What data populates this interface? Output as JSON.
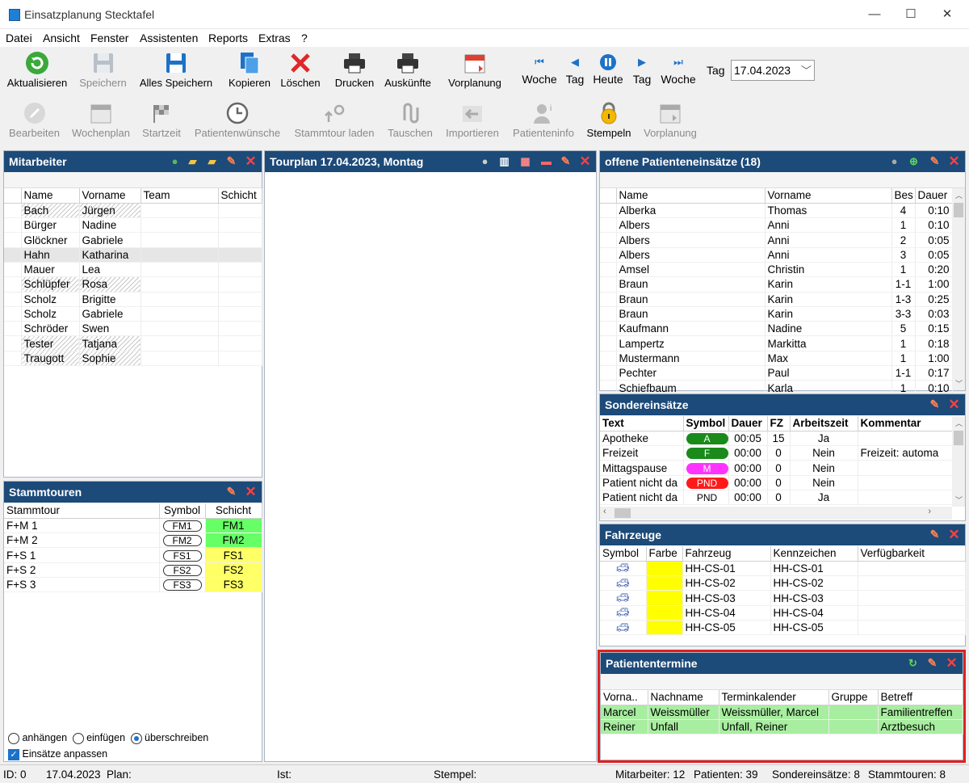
{
  "window": {
    "title": "Einsatzplanung Stecktafel",
    "minimize": "—",
    "maximize": "☐",
    "close": "✕"
  },
  "menu": [
    "Datei",
    "Ansicht",
    "Fenster",
    "Assistenten",
    "Reports",
    "Extras",
    "?"
  ],
  "toolbar1": [
    "Aktualisieren",
    "Speichern",
    "Alles Speichern",
    "Kopieren",
    "Löschen",
    "Drucken",
    "Auskünfte",
    "Vorplanung"
  ],
  "nav": {
    "week_back": "Woche",
    "day_back": "Tag",
    "today": "Heute",
    "day_fwd": "Tag",
    "week_fwd": "Woche",
    "date_label": "Tag",
    "date_value": "17.04.2023"
  },
  "toolbar2": [
    "Bearbeiten",
    "Wochenplan",
    "Startzeit",
    "Patientenwünsche",
    "Stammtour laden",
    "Tauschen",
    "Importieren",
    "Patienteninfo",
    "Stempeln",
    "Vorplanung"
  ],
  "mitarbeiter": {
    "title": "Mitarbeiter",
    "columns": [
      "Name",
      "Vorname",
      "Team",
      "Schicht"
    ],
    "rows": [
      [
        "Bach",
        "Jürgen"
      ],
      [
        "Bürger",
        "Nadine"
      ],
      [
        "Glöckner",
        "Gabriele"
      ],
      [
        "Hahn",
        "Katharina"
      ],
      [
        "Mauer",
        "Lea"
      ],
      [
        "Schlüpfer",
        "Rosa"
      ],
      [
        "Scholz",
        "Brigitte"
      ],
      [
        "Scholz",
        "Gabriele"
      ],
      [
        "Schröder",
        "Swen"
      ],
      [
        "Tester",
        "Tatjana"
      ],
      [
        "Traugott",
        "Sophie"
      ]
    ]
  },
  "tourplan": {
    "title": "Tourplan 17.04.2023, Montag"
  },
  "stammtouren": {
    "title": "Stammtouren",
    "columns": [
      "Stammtour",
      "Symbol",
      "Schicht"
    ],
    "rows": [
      [
        "F+M 1",
        "FM1",
        "FM1"
      ],
      [
        "F+M 2",
        "FM2",
        "FM2"
      ],
      [
        "F+S 1",
        "FS1",
        "FS1"
      ],
      [
        "F+S 2",
        "FS2",
        "FS2"
      ],
      [
        "F+S 3",
        "FS3",
        "FS3"
      ]
    ],
    "options": [
      "anhängen",
      "einfügen",
      "überschreiben"
    ],
    "checkbox": "Einsätze anpassen"
  },
  "offene": {
    "title": "offene Patienteneinsätze (18)",
    "columns": [
      "Name",
      "Vorname",
      "Bes",
      "Dauer"
    ],
    "rows": [
      [
        "Alberka",
        "Thomas",
        "4",
        "0:10"
      ],
      [
        "Albers",
        "Anni",
        "1",
        "0:10"
      ],
      [
        "Albers",
        "Anni",
        "2",
        "0:05"
      ],
      [
        "Albers",
        "Anni",
        "3",
        "0:05"
      ],
      [
        "Amsel",
        "Christin",
        "1",
        "0:20"
      ],
      [
        "Braun",
        "Karin",
        "1-1",
        "1:00"
      ],
      [
        "Braun",
        "Karin",
        "1-3",
        "0:25"
      ],
      [
        "Braun",
        "Karin",
        "3-3",
        "0:03"
      ],
      [
        "Kaufmann",
        "Nadine",
        "5",
        "0:15"
      ],
      [
        "Lampertz",
        "Markitta",
        "1",
        "0:18"
      ],
      [
        "Mustermann",
        "Max",
        "1",
        "1:00"
      ],
      [
        "Pechter",
        "Paul",
        "1-1",
        "0:17"
      ],
      [
        "Schiefbaum",
        "Karla",
        "1",
        "0:10"
      ]
    ]
  },
  "sonder": {
    "title": "Sondereinsätze",
    "columns": [
      "Text",
      "Symbol",
      "Dauer",
      "FZ",
      "Arbeitszeit",
      "Kommentar"
    ],
    "rows": [
      {
        "text": "Apotheke",
        "symbol": "A",
        "color": "#1a8a1a",
        "dauer": "00:05",
        "fz": "15",
        "az": "Ja",
        "kommentar": ""
      },
      {
        "text": "Freizeit",
        "symbol": "F",
        "color": "#1a8a1a",
        "dauer": "00:00",
        "fz": "0",
        "az": "Nein",
        "kommentar": "Freizeit: automa"
      },
      {
        "text": "Mittagspause",
        "symbol": "M",
        "color": "#ff33ff",
        "dauer": "00:00",
        "fz": "0",
        "az": "Nein",
        "kommentar": ""
      },
      {
        "text": "Patient nicht da",
        "symbol": "PND",
        "color": "#ff1a1a",
        "dauer": "00:00",
        "fz": "0",
        "az": "Nein",
        "kommentar": ""
      },
      {
        "text": "Patient nicht da",
        "symbol": "PND",
        "color": "",
        "dauer": "00:00",
        "fz": "0",
        "az": "Ja",
        "kommentar": ""
      }
    ]
  },
  "fahrzeuge": {
    "title": "Fahrzeuge",
    "columns": [
      "Symbol",
      "Farbe",
      "Fahrzeug",
      "Kennzeichen",
      "Verfügbarkeit"
    ],
    "rows": [
      [
        "HH-CS-01",
        "HH-CS-01"
      ],
      [
        "HH-CS-02",
        "HH-CS-02"
      ],
      [
        "HH-CS-03",
        "HH-CS-03"
      ],
      [
        "HH-CS-04",
        "HH-CS-04"
      ],
      [
        "HH-CS-05",
        "HH-CS-05"
      ]
    ]
  },
  "termine": {
    "title": "Patiententermine",
    "columns": [
      "Vorna..",
      "Nachname",
      "Terminkalender",
      "Gruppe",
      "Betreff"
    ],
    "rows": [
      [
        "Marcel",
        "Weissmüller",
        "Weissmüller, Marcel",
        "",
        "Familientreffen"
      ],
      [
        "Reiner",
        "Unfall",
        "Unfall, Reiner",
        "",
        "Arztbesuch"
      ]
    ]
  },
  "status": {
    "id": "ID: 0",
    "date": "17.04.2023",
    "plan": "Plan:",
    "ist": "Ist:",
    "stempel": "Stempel:",
    "mitarbeiter": "Mitarbeiter: 12",
    "patienten": "Patienten: 39",
    "sonder": "Sondereinsätze: 8",
    "stammtouren": "Stammtouren: 8"
  },
  "colors": {
    "panel_header": "#1c4a79",
    "green_row": "#a8eea0",
    "yellow": "#ffff00",
    "fm_green": "#66ff66",
    "fs_yellow": "#ffff66",
    "highlight_border": "#e02020"
  }
}
